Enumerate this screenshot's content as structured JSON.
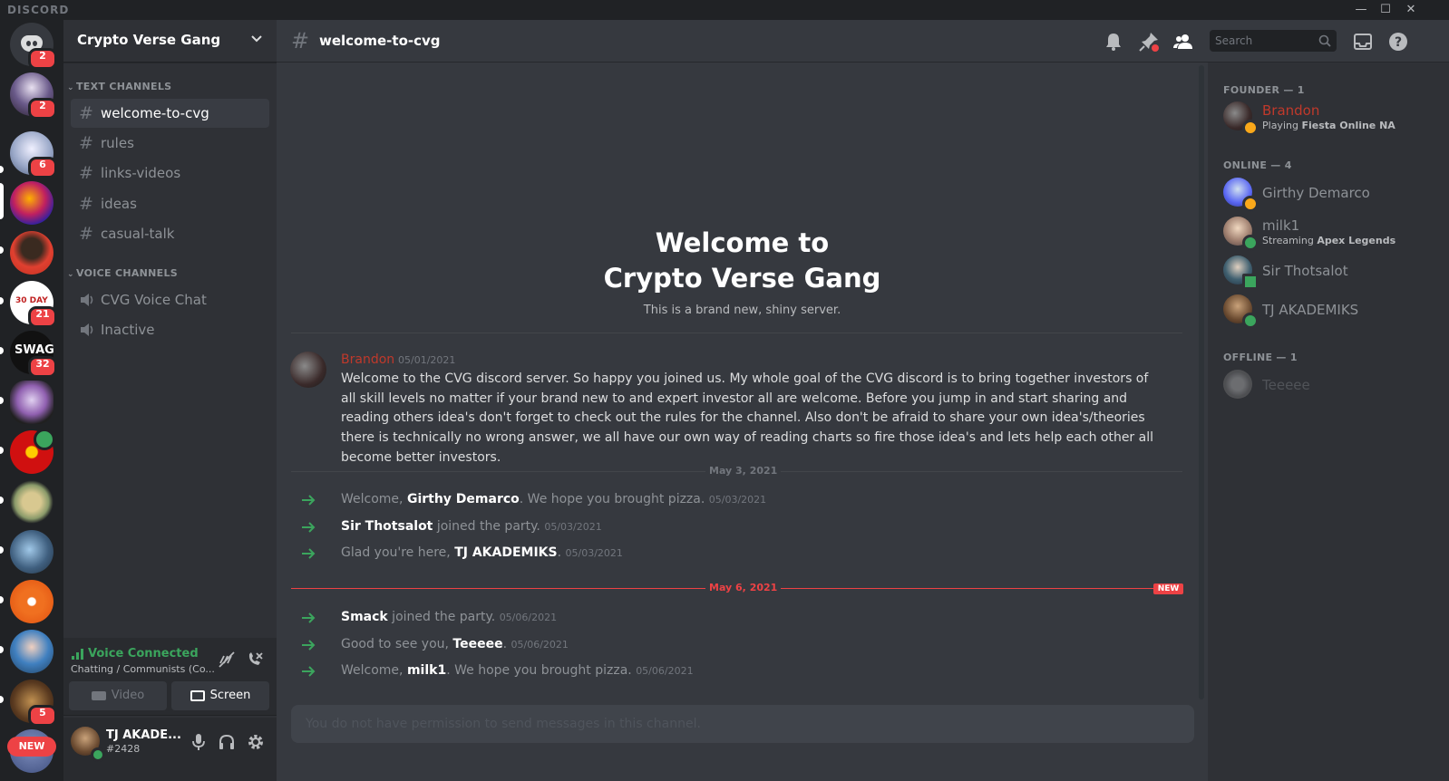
{
  "app": {
    "brand": "DISCORD"
  },
  "window": {
    "minimize": "—",
    "maximize": "☐",
    "close": "✕"
  },
  "servers": [
    {
      "id": "home",
      "badge": "2"
    },
    {
      "id": "srv1",
      "badge": "2"
    },
    {
      "id": "srv2",
      "badge": "6"
    },
    {
      "id": "srv3",
      "badge": ""
    },
    {
      "id": "srv4",
      "badge": ""
    },
    {
      "id": "srv5",
      "badge": "21",
      "art_text": "30 DAY"
    },
    {
      "id": "srv6",
      "badge": "32",
      "art_text": "SWAG"
    },
    {
      "id": "srv7",
      "badge": ""
    },
    {
      "id": "srv8",
      "badge": ""
    },
    {
      "id": "srv9",
      "badge": ""
    },
    {
      "id": "srv10",
      "badge": ""
    },
    {
      "id": "srv11",
      "badge": ""
    },
    {
      "id": "srv12",
      "badge": ""
    },
    {
      "id": "srv13",
      "badge": "5"
    },
    {
      "id": "srv14",
      "badge": "NEW"
    }
  ],
  "guild": {
    "name": "Crypto Verse Gang"
  },
  "categories": {
    "text": "TEXT CHANNELS",
    "voice": "VOICE CHANNELS"
  },
  "text_channels": [
    {
      "name": "welcome-to-cvg",
      "active": true
    },
    {
      "name": "rules"
    },
    {
      "name": "links-videos"
    },
    {
      "name": "ideas"
    },
    {
      "name": "casual-talk"
    }
  ],
  "voice_channels": [
    {
      "name": "CVG Voice Chat"
    },
    {
      "name": "Inactive"
    }
  ],
  "voice": {
    "status": "Voice Connected",
    "detail": "Chatting / Communists (Co...",
    "video": "Video",
    "screen": "Screen"
  },
  "user": {
    "name": "TJ AKADE...",
    "tag": "#2428"
  },
  "header": {
    "channel": "welcome-to-cvg",
    "search_placeholder": "Search"
  },
  "welcome": {
    "line1": "Welcome to",
    "line2": "Crypto Verse Gang",
    "subtitle": "This is a brand new, shiny server."
  },
  "message": {
    "author": "Brandon",
    "timestamp": "05/01/2021",
    "body": "Welcome to the CVG discord server. So happy you joined us. My whole goal of the CVG discord is to bring together investors of all skill levels no matter if your brand new to and expert investor all are welcome. Before you jump in and start sharing and reading others idea's don't forget to check out the rules for the channel. Also don't be afraid to share your own idea's/theories there is technically no wrong answer, we all have our own way of reading charts so fire those idea's and lets help each other all become better investors."
  },
  "dividers": {
    "first": "May 3, 2021",
    "second": "May 6, 2021",
    "new_tag": "NEW"
  },
  "system_messages": [
    {
      "pre": "Welcome, ",
      "name": "Girthy Demarco",
      "post": ". We hope you brought pizza.",
      "ts": "05/03/2021"
    },
    {
      "pre": "",
      "name": "Sir Thotsalot",
      "post": " joined the party.",
      "ts": "05/03/2021"
    },
    {
      "pre": "Glad you're here, ",
      "name": "TJ AKADEMIKS",
      "post": ".",
      "ts": "05/03/2021"
    },
    {
      "pre": "",
      "name": "Smack",
      "post": " joined the party.",
      "ts": "05/06/2021"
    },
    {
      "pre": "Good to see you, ",
      "name": "Teeeee",
      "post": ".",
      "ts": "05/06/2021"
    },
    {
      "pre": "Welcome, ",
      "name": "milk1",
      "post": ". We hope you brought pizza.",
      "ts": "05/06/2021"
    }
  ],
  "composer": {
    "placeholder": "You do not have permission to send messages in this channel."
  },
  "members": {
    "founder_header": "FOUNDER — 1",
    "online_header": "ONLINE — 4",
    "offline_header": "OFFLINE — 1",
    "founder": [
      {
        "name": "Brandon",
        "activity_pre": "Playing ",
        "activity": "Fiesta Online NA",
        "color": "#c0392b"
      }
    ],
    "online": [
      {
        "name": "Girthy Demarco",
        "activity_pre": "",
        "activity": ""
      },
      {
        "name": "milk1",
        "activity_pre": "Streaming ",
        "activity": "Apex Legends"
      },
      {
        "name": "Sir Thotsalot",
        "activity_pre": "",
        "activity": ""
      },
      {
        "name": "TJ AKADEMIKS",
        "activity_pre": "",
        "activity": ""
      }
    ],
    "offline": [
      {
        "name": "Teeeee"
      }
    ]
  },
  "colors": {
    "online": "#3ba55d",
    "idle": "#faa81a",
    "danger": "#ed4245",
    "brand": "#5865f2"
  }
}
